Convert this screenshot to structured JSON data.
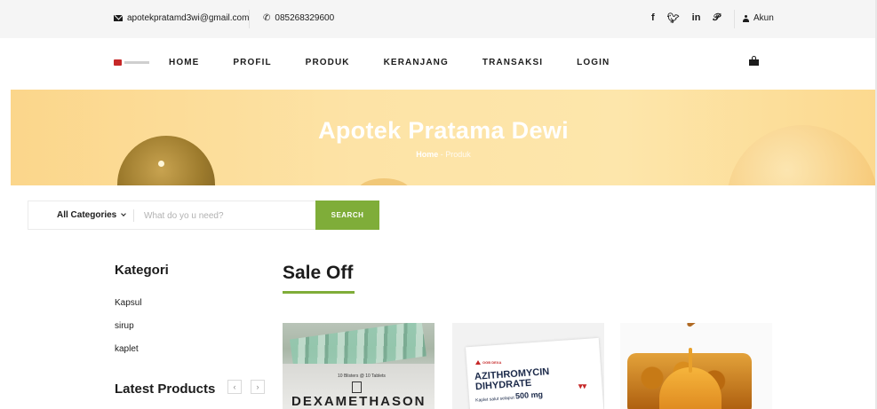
{
  "topbar": {
    "email": "apotekpratamd3wi@gmail.com",
    "phone": "085268329600",
    "social": [
      "f",
      "𝕪",
      "in",
      "℗"
    ],
    "account_label": "Akun"
  },
  "header": {
    "nav": [
      "HOME",
      "PROFIL",
      "PRODUK",
      "KERANJANG",
      "TRANSAKSI",
      "LOGIN"
    ]
  },
  "hero": {
    "title": "Apotek Pratama Dewi",
    "breadcrumb_home": "Home",
    "breadcrumb_current": "- Produk"
  },
  "search": {
    "category_label": "All Categories",
    "placeholder": "What do yo u need?",
    "button_label": "SEARCH"
  },
  "sidebar": {
    "title": "Kategori",
    "items": [
      "Kapsul",
      "sirup",
      "kaplet"
    ],
    "latest_title": "Latest Products",
    "prev": "‹",
    "next": "›"
  },
  "sale": {
    "title": "Sale Off",
    "products": [
      {
        "box_text": "10 Blisters @ 10 Tablets",
        "name": "DEXAMETHASON"
      },
      {
        "brand": "OGB DEXA",
        "name_line1": "AZITHROMYCIN",
        "name_line2": "DIHYDRATE",
        "subtitle": "Kaplet salut selaput",
        "strength": "500 mg"
      },
      {
        "kind": "honey"
      }
    ]
  },
  "colors": {
    "accent_green": "#7fad39",
    "hero_bg": "#fde3a6",
    "topbar_bg": "#f5f5f5"
  }
}
